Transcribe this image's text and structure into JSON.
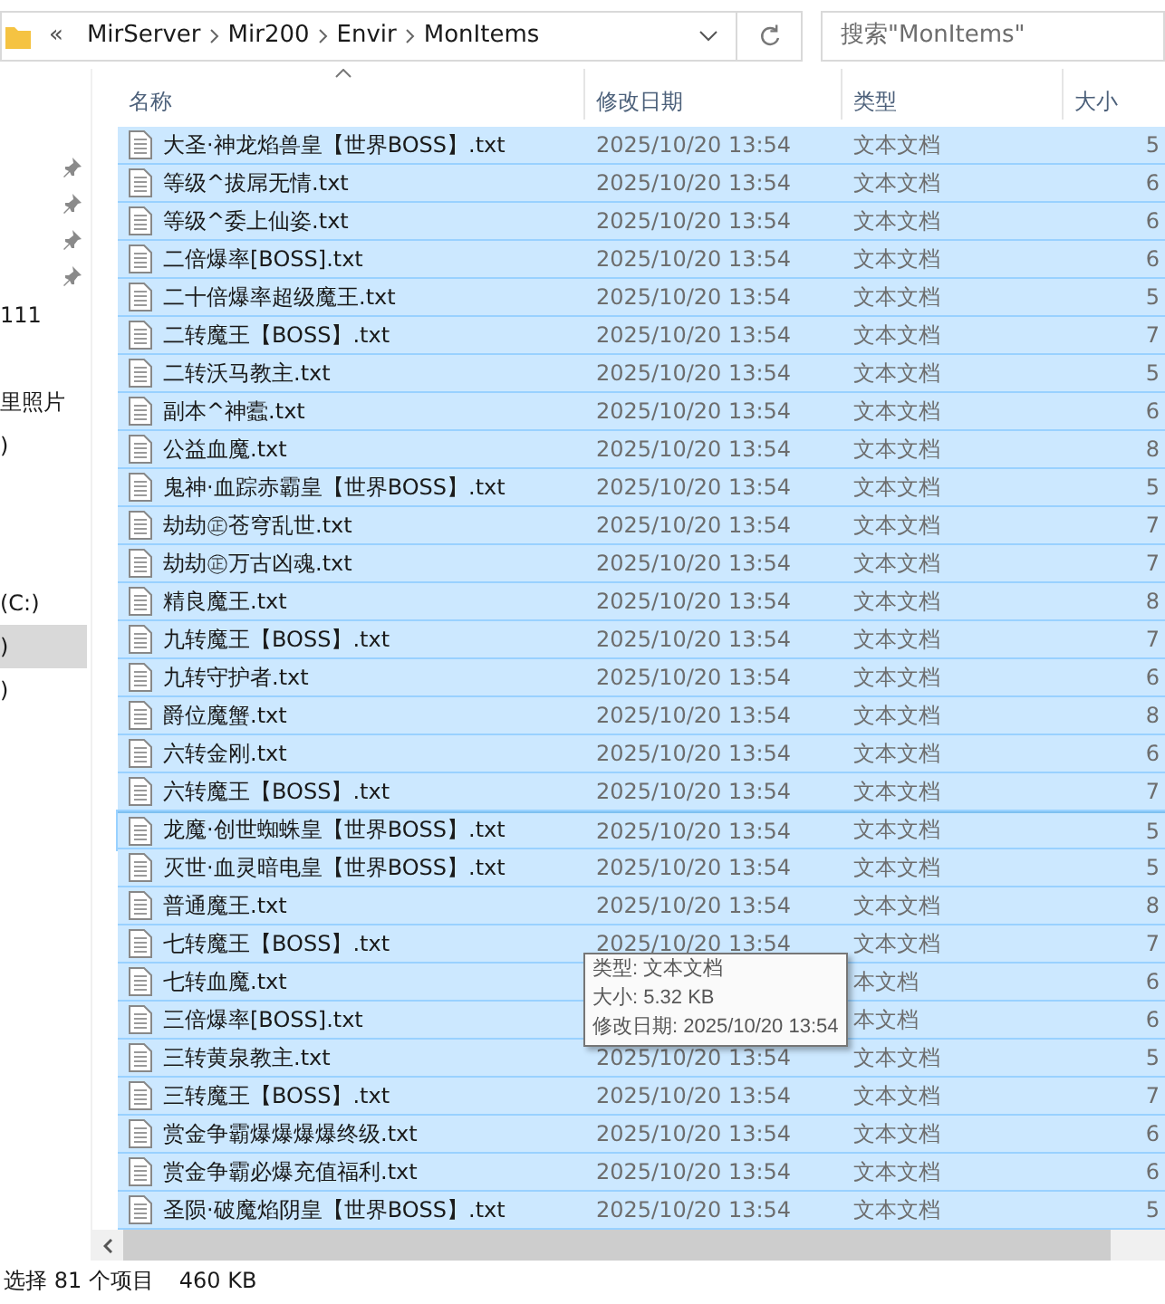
{
  "address_bar": {
    "overflow": "«",
    "path": [
      "MirServer",
      "Mir200",
      "Envir",
      "MonItems"
    ]
  },
  "search": {
    "placeholder": "搜索\"MonItems\""
  },
  "sidebar": {
    "pinned": [
      {
        "pinned": true
      },
      {
        "pinned": true
      },
      {
        "pinned": true
      },
      {
        "pinned": true
      }
    ],
    "items": [
      {
        "label": "111",
        "selected": false
      },
      {
        "label": "里照片",
        "selected": false
      },
      {
        "label": ")",
        "selected": false
      },
      {
        "label": "(C:)",
        "selected": false
      },
      {
        "label": ")",
        "selected": true
      },
      {
        "label": ")",
        "selected": false
      }
    ]
  },
  "table": {
    "columns": [
      "名称",
      "修改日期",
      "类型",
      "大小"
    ],
    "sort_ascending": true,
    "rows": [
      {
        "name": "大圣·神龙焰兽皇【世界BOSS】.txt",
        "modified": "2025/10/20 13:54",
        "type": "文本文档",
        "size": "5",
        "selected": true,
        "focused": false
      },
      {
        "name": "等级^拔屌无情.txt",
        "modified": "2025/10/20 13:54",
        "type": "文本文档",
        "size": "6",
        "selected": true,
        "focused": false
      },
      {
        "name": "等级^委上仙姿.txt",
        "modified": "2025/10/20 13:54",
        "type": "文本文档",
        "size": "6",
        "selected": true,
        "focused": false
      },
      {
        "name": "二倍爆率[BOSS].txt",
        "modified": "2025/10/20 13:54",
        "type": "文本文档",
        "size": "6",
        "selected": true,
        "focused": false
      },
      {
        "name": "二十倍爆率超级魔王.txt",
        "modified": "2025/10/20 13:54",
        "type": "文本文档",
        "size": "5",
        "selected": true,
        "focused": false
      },
      {
        "name": "二转魔王【BOSS】.txt",
        "modified": "2025/10/20 13:54",
        "type": "文本文档",
        "size": "7",
        "selected": true,
        "focused": false
      },
      {
        "name": "二转沃马教主.txt",
        "modified": "2025/10/20 13:54",
        "type": "文本文档",
        "size": "5",
        "selected": true,
        "focused": false
      },
      {
        "name": "副本^神蠹.txt",
        "modified": "2025/10/20 13:54",
        "type": "文本文档",
        "size": "6",
        "selected": true,
        "focused": false
      },
      {
        "name": "公益血魔.txt",
        "modified": "2025/10/20 13:54",
        "type": "文本文档",
        "size": "8",
        "selected": true,
        "focused": false
      },
      {
        "name": "鬼神·血踪赤霸皇【世界BOSS】.txt",
        "modified": "2025/10/20 13:54",
        "type": "文本文档",
        "size": "5",
        "selected": true,
        "focused": false
      },
      {
        "name": "劫劫㊣苍穹乱世.txt",
        "modified": "2025/10/20 13:54",
        "type": "文本文档",
        "size": "7",
        "selected": true,
        "focused": false
      },
      {
        "name": "劫劫㊣万古凶魂.txt",
        "modified": "2025/10/20 13:54",
        "type": "文本文档",
        "size": "7",
        "selected": true,
        "focused": false
      },
      {
        "name": "精良魔王.txt",
        "modified": "2025/10/20 13:54",
        "type": "文本文档",
        "size": "8",
        "selected": true,
        "focused": false
      },
      {
        "name": "九转魔王【BOSS】.txt",
        "modified": "2025/10/20 13:54",
        "type": "文本文档",
        "size": "7",
        "selected": true,
        "focused": false
      },
      {
        "name": "九转守护者.txt",
        "modified": "2025/10/20 13:54",
        "type": "文本文档",
        "size": "6",
        "selected": true,
        "focused": false
      },
      {
        "name": "爵位魔蟹.txt",
        "modified": "2025/10/20 13:54",
        "type": "文本文档",
        "size": "8",
        "selected": true,
        "focused": false
      },
      {
        "name": "六转金刚.txt",
        "modified": "2025/10/20 13:54",
        "type": "文本文档",
        "size": "6",
        "selected": true,
        "focused": false
      },
      {
        "name": "六转魔王【BOSS】.txt",
        "modified": "2025/10/20 13:54",
        "type": "文本文档",
        "size": "7",
        "selected": true,
        "focused": false
      },
      {
        "name": "龙魔·创世蜘蛛皇【世界BOSS】.txt",
        "modified": "2025/10/20 13:54",
        "type": "文本文档",
        "size": "5",
        "selected": true,
        "focused": true
      },
      {
        "name": "灭世·血灵暗电皇【世界BOSS】.txt",
        "modified": "2025/10/20 13:54",
        "type": "文本文档",
        "size": "5",
        "selected": true,
        "focused": false
      },
      {
        "name": "普通魔王.txt",
        "modified": "2025/10/20 13:54",
        "type": "文本文档",
        "size": "8",
        "selected": true,
        "focused": false
      },
      {
        "name": "七转魔王【BOSS】.txt",
        "modified": "2025/10/20 13:54",
        "type": "文本文档",
        "size": "7",
        "selected": true,
        "focused": false
      },
      {
        "name": "七转血魔.txt",
        "type": "本文档",
        "type_clipped": true,
        "size": "6",
        "selected": true,
        "focused": false
      },
      {
        "name": "三倍爆率[BOSS].txt",
        "type": "本文档",
        "type_clipped": true,
        "size": "6",
        "selected": true,
        "focused": false
      },
      {
        "name": "三转黄泉教主.txt",
        "modified": "2025/10/20 13:54",
        "type": "文本文档",
        "size": "5",
        "selected": true,
        "focused": false
      },
      {
        "name": "三转魔王【BOSS】.txt",
        "modified": "2025/10/20 13:54",
        "type": "文本文档",
        "size": "7",
        "selected": true,
        "focused": false
      },
      {
        "name": "赏金争霸爆爆爆爆终级.txt",
        "modified": "2025/10/20 13:54",
        "type": "文本文档",
        "size": "6",
        "selected": true,
        "focused": false
      },
      {
        "name": "赏金争霸必爆充值福利.txt",
        "modified": "2025/10/20 13:54",
        "type": "文本文档",
        "size": "6",
        "selected": true,
        "focused": false
      },
      {
        "name": "圣陨·破魔焰阴皇【世界BOSS】.txt",
        "modified": "2025/10/20 13:54",
        "type": "文本文档",
        "size": "5",
        "selected": true,
        "focused": false
      }
    ]
  },
  "tooltip": {
    "lines": [
      "类型: 文本文档",
      "大小: 5.32 KB",
      "修改日期: 2025/10/20 13:54"
    ]
  },
  "status_bar": {
    "selection": "选择 81 个项目",
    "size": "460 KB"
  }
}
